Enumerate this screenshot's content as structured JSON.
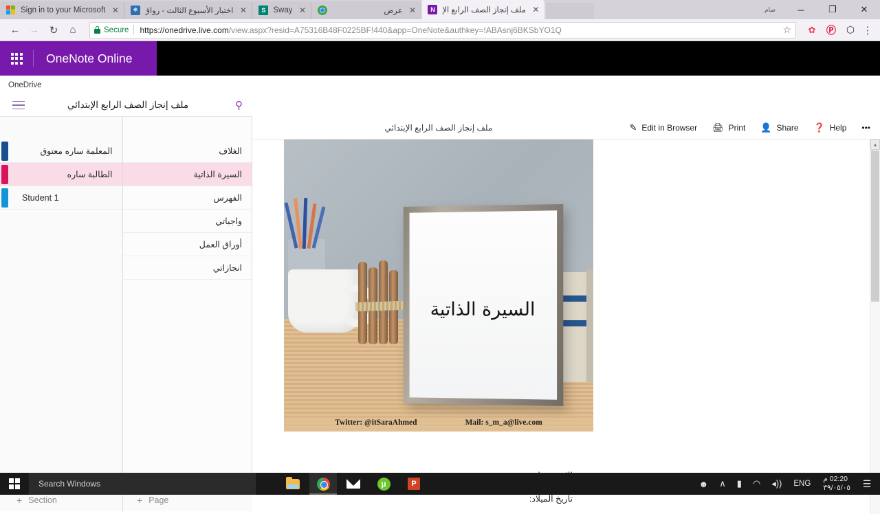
{
  "browser": {
    "tabs": [
      {
        "title": "Sign in to your Microsoft",
        "favicon": "microsoft-icon",
        "rtl": false,
        "active": false,
        "close_label": "✕"
      },
      {
        "title": "اختبار الأسبوع الثالث - رواق",
        "favicon": "shield-icon",
        "rtl": true,
        "active": false,
        "close_label": "✕"
      },
      {
        "title": "Sway",
        "favicon": "sway-icon",
        "rtl": false,
        "active": false,
        "close_label": "✕"
      },
      {
        "title": "عرض",
        "favicon": "chrome-icon",
        "rtl": true,
        "active": false,
        "close_label": "✕"
      },
      {
        "title": "ملف إنجاز الصف الرابع الإ",
        "favicon": "onenote-icon",
        "rtl": true,
        "active": true,
        "close_label": "✕"
      }
    ],
    "window_controls": {
      "ime_badge": "صام",
      "minimize": "─",
      "maximize": "❐",
      "close": "✕"
    },
    "toolbar": {
      "back": "←",
      "forward": "→",
      "reload": "↻",
      "home": "⌂",
      "secure_label": "Secure",
      "url_domain": "https://onedrive.live.com",
      "url_path": "/view.aspx?resid=A75316B48F0225BF!440&app=OneNote&authkey=!ABAsnj6BKSbYO1Q",
      "star": "☆",
      "ext_pocket": "✿",
      "ext_pinterest": "Ⓟ",
      "ext_box": "⬡",
      "menu": "⋮"
    }
  },
  "suite": {
    "app_launcher": "waffle-icon",
    "title": "OneNote Online"
  },
  "breadcrumb": {
    "onedrive": "OneDrive"
  },
  "notebook_header": {
    "menu_icon": "hamburger-icon",
    "title": "ملف إنجاز الصف الرابع الإبتدائي",
    "search_icon": "search-icon"
  },
  "sections": [
    {
      "label": "المعلمة ساره معتوق",
      "color": "#17508F",
      "selected": false,
      "rtl": true
    },
    {
      "label": "الطالبة ساره",
      "color": "#D6155C",
      "selected": true,
      "rtl": true
    },
    {
      "label": "Student 1",
      "color": "#1296D6",
      "selected": false,
      "rtl": false
    }
  ],
  "pages": [
    {
      "label": "الغلاف",
      "selected": false
    },
    {
      "label": "السيرة الذاتية",
      "selected": true
    },
    {
      "label": "الفهرس",
      "selected": false
    },
    {
      "label": "واجباتي",
      "selected": false
    },
    {
      "label": "أوراق العمل",
      "selected": false
    },
    {
      "label": "انجازاتي",
      "selected": false
    }
  ],
  "add_buttons": {
    "section": "Section",
    "page": "Page",
    "plus": "+"
  },
  "content": {
    "doc_title": "ملف إنجاز الصف الرابع الإبتدائي",
    "commands": [
      {
        "label": "Edit in Browser",
        "icon": "pencil-icon",
        "glyph": "✐"
      },
      {
        "label": "Print",
        "icon": "printer-icon",
        "glyph": "⎙"
      },
      {
        "label": "Share",
        "icon": "share-person-icon",
        "glyph": "☻"
      },
      {
        "label": "Help",
        "icon": "help-circle-icon",
        "glyph": "❓"
      }
    ],
    "overflow": "•••",
    "image": {
      "calligraphy": "السيرة الذاتية",
      "caption_twitter": "Twitter: @itSaraAhmed",
      "caption_mail": "Mail: s_m_a@live.com"
    },
    "body_lines": [
      "الاسم: ساره",
      "تاريخ الميلاد:"
    ],
    "scroll_up_arrow": "▴"
  },
  "taskbar": {
    "start_icon": "windows-logo-icon",
    "search_placeholder": "Search Windows",
    "apps": [
      {
        "name": "file-explorer-icon",
        "active": false
      },
      {
        "name": "chrome-icon",
        "active": true
      },
      {
        "name": "mail-icon",
        "active": false
      },
      {
        "name": "utorrent-icon",
        "active": false,
        "glyph": "μ"
      },
      {
        "name": "powerpoint-icon",
        "active": false,
        "glyph": "P"
      }
    ],
    "tray": {
      "people": "☻",
      "chevron": "∧",
      "battery": "▮",
      "wifi": "◠",
      "volume": "◂))",
      "language": "ENG",
      "time": "02:20 م",
      "date": "٣٩/٠٥/٠٥",
      "action_center": "☰"
    }
  }
}
